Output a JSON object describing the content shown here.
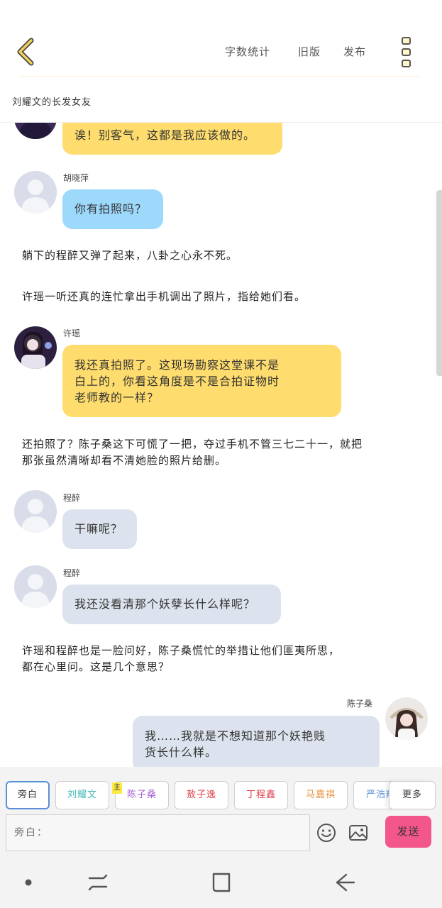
{
  "header": {
    "back_icon": "chevron-left-icon",
    "actions": {
      "word_count": "字数统计",
      "old_version": "旧版",
      "publish": "发布"
    },
    "menu_icon": "vertical-dots-icon",
    "accent_color": "#e9c84a"
  },
  "story_title": "刘耀文的长发女友",
  "messages": [
    {
      "type": "bubble",
      "speaker": "",
      "avatar": "photo",
      "color": "yellow",
      "lines": [
        "诶！别客气，这都是我应该做的。"
      ]
    },
    {
      "type": "bubble",
      "speaker": "胡晓萍",
      "avatar": "default",
      "color": "blue",
      "lines": [
        "你有拍照吗？"
      ]
    },
    {
      "type": "narration",
      "lines": [
        "躺下的程醉又弹了起来，八卦之心永不死。"
      ]
    },
    {
      "type": "narration",
      "lines": [
        "许瑶一听还真的连忙拿出手机调出了照片，指给她们看。"
      ]
    },
    {
      "type": "bubble",
      "speaker": "许瑶",
      "avatar": "photo",
      "color": "yellow",
      "lines": [
        "我还真拍照了。这现场勘察这堂课不是",
        "白上的，你看这角度是不是合拍证物时",
        "老师教的一样？"
      ]
    },
    {
      "type": "narration",
      "lines": [
        "还拍照了？陈子桑这下可慌了一把，夺过手机不管三七二十一，就把",
        "那张虽然清晰却看不清她脸的照片给删。"
      ]
    },
    {
      "type": "bubble",
      "speaker": "程醉",
      "avatar": "default",
      "color": "gray",
      "lines": [
        "干嘛呢？"
      ]
    },
    {
      "type": "bubble",
      "speaker": "程醉",
      "avatar": "default",
      "color": "gray",
      "lines": [
        "我还没看清那个妖孽长什么样呢？"
      ]
    },
    {
      "type": "narration",
      "lines": [
        "许瑶和程醉也是一脸问好，陈子桑慌忙的举措让他们匪夷所思，",
        "都在心里问。这是几个意思？"
      ]
    },
    {
      "type": "bubble",
      "speaker": "陈子桑",
      "avatar": "photo",
      "color": "gray",
      "align": "right",
      "lines": [
        "我……我就是不想知道那个妖艳贱",
        "货长什么样。"
      ]
    }
  ],
  "characters": {
    "items": [
      {
        "label": "旁白",
        "color": "#333333",
        "active": true
      },
      {
        "label": "刘耀文",
        "color": "#3fb6b6"
      },
      {
        "label": "陈子桑",
        "color": "#a85fd6",
        "tag": "主"
      },
      {
        "label": "敖子逸",
        "color": "#e0414a"
      },
      {
        "label": "丁程鑫",
        "color": "#e0414a"
      },
      {
        "label": "马嘉祺",
        "color": "#e8913f"
      },
      {
        "label": "严浩翔",
        "color": "#5c8fd6"
      }
    ],
    "more": "更多"
  },
  "input": {
    "placeholder": "旁白：",
    "emoji_icon": "smiley-icon",
    "image_icon": "image-icon",
    "send": "发送"
  },
  "system_nav": [
    "dot-icon",
    "recents-icon",
    "home-icon",
    "back-arrow-icon"
  ]
}
